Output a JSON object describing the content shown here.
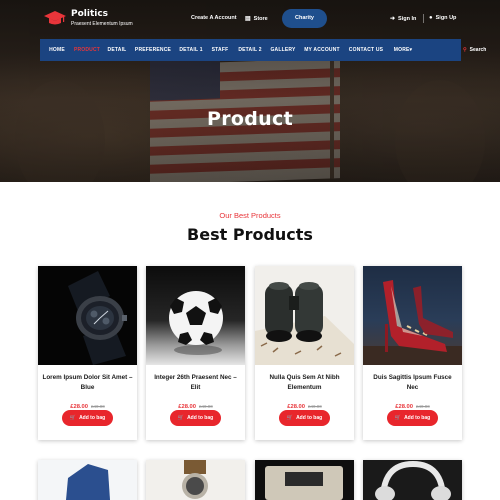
{
  "header": {
    "logo_name": "Politics",
    "logo_tagline": "Praesent Elementum Ipsum",
    "create_account": "Create A Account",
    "store": "Store",
    "charity": "Charity",
    "sign_in": "Sign In",
    "sign_up": "Sign Up"
  },
  "nav": {
    "items": [
      "HOME",
      "PRODUCT",
      "DETAIL",
      "PREFERENCE",
      "DETAIL 1",
      "STAFF",
      "DETAIL 2",
      "GALLERY",
      "MY ACCOUNT",
      "CONTACT US",
      "MORE"
    ],
    "active_index": 1,
    "search_label": "Search"
  },
  "hero": {
    "title": "Product"
  },
  "section": {
    "subtitle": "Our Best Products",
    "title": "Best Products"
  },
  "products": [
    {
      "name": "Lorem Ipsum Dolor Sit Amet – Blue",
      "price": "£28.00",
      "old_price": "£40.00",
      "button": "Add to bag",
      "image_icon": "watch-image"
    },
    {
      "name": "Integer 26th Praesent Nec – Elit",
      "price": "£28.00",
      "old_price": "£40.00",
      "button": "Add to bag",
      "image_icon": "soccer-ball-image"
    },
    {
      "name": "Nulla Quis Sem At Nibh Elementum",
      "price": "£28.00",
      "old_price": "£40.00",
      "button": "Add to bag",
      "image_icon": "binoculars-image"
    },
    {
      "name": "Duis Sagittis Ipsum Fusce Nec",
      "price": "£28.00",
      "old_price": "£40.00",
      "button": "Add to bag",
      "image_icon": "high-heel-image"
    }
  ],
  "colors": {
    "accent": "#e8353a",
    "nav_bg": "#1b4481",
    "button_bg": "#e8262c",
    "charity_bg": "#1f4f8d"
  }
}
